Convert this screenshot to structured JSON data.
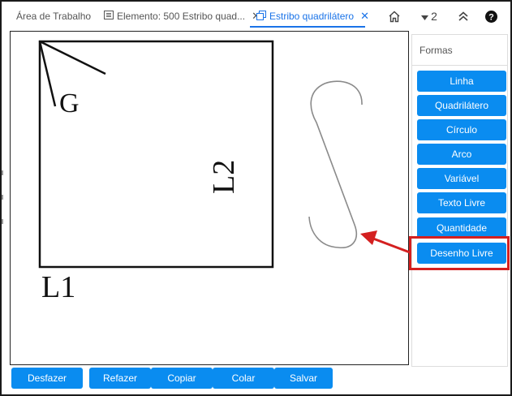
{
  "tabs": [
    {
      "label": "Área de Trabalho",
      "closable": false,
      "active": false
    },
    {
      "label": "Elemento: 500 Estribo quad...",
      "closable": true,
      "active": false,
      "icon": "list-icon"
    },
    {
      "label": "Estribo quadrilátero",
      "closable": true,
      "active": true,
      "icon": "copy-icon"
    }
  ],
  "toolbar": {
    "home_icon": "home-icon",
    "count_label": "2",
    "collapse_icon": "double-chevron-up-icon",
    "help_icon": "help-icon"
  },
  "canvas": {
    "label_g": "G",
    "label_l1": "L1",
    "label_l2": "L2"
  },
  "panel": {
    "title": "Formas",
    "buttons": [
      "Linha",
      "Quadrilátero",
      "Círculo",
      "Arco",
      "Variável",
      "Texto Livre",
      "Quantidade",
      "Desenho Livre"
    ]
  },
  "actions": [
    "Desfazer",
    "Refazer",
    "Copiar",
    "Colar",
    "Salvar"
  ],
  "colors": {
    "accent": "#0a8cf0",
    "active_tab": "#1a73e8",
    "highlight": "#d42020"
  }
}
